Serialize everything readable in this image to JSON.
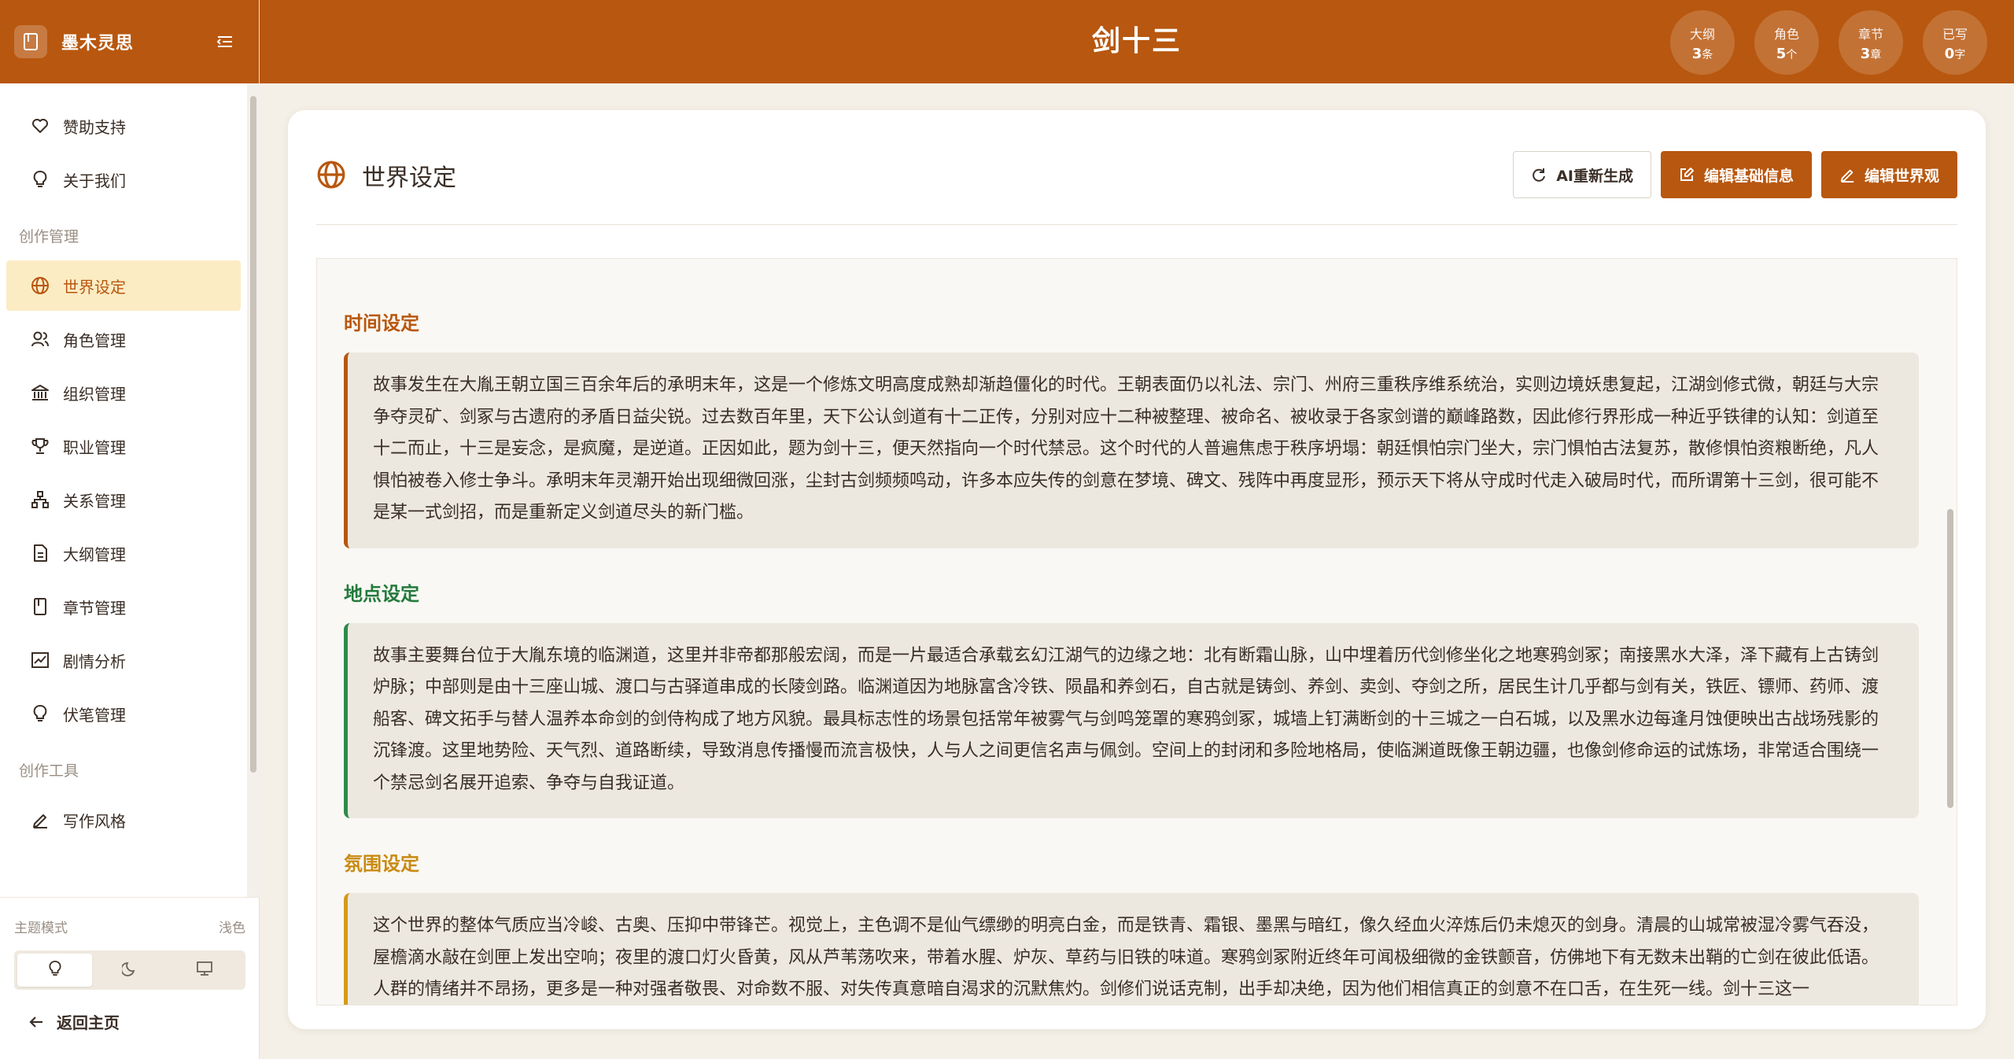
{
  "app": {
    "name": "墨木灵思",
    "novel_title": "剑十三"
  },
  "stats": [
    {
      "label": "大纲",
      "value": "3",
      "unit": "条"
    },
    {
      "label": "角色",
      "value": "5",
      "unit": "个"
    },
    {
      "label": "章节",
      "value": "3",
      "unit": "章"
    },
    {
      "label": "已写",
      "value": "0",
      "unit": "字"
    }
  ],
  "sidebar": {
    "top_items": [
      {
        "label": "赞助支持",
        "icon": "heart-icon"
      },
      {
        "label": "关于我们",
        "icon": "lightbulb-icon"
      }
    ],
    "group_manage": "创作管理",
    "manage_items": [
      {
        "label": "世界设定",
        "icon": "globe-icon",
        "active": true
      },
      {
        "label": "角色管理",
        "icon": "users-icon"
      },
      {
        "label": "组织管理",
        "icon": "building-icon"
      },
      {
        "label": "职业管理",
        "icon": "trophy-icon"
      },
      {
        "label": "关系管理",
        "icon": "network-icon"
      },
      {
        "label": "大纲管理",
        "icon": "document-icon"
      },
      {
        "label": "章节管理",
        "icon": "book-icon"
      },
      {
        "label": "剧情分析",
        "icon": "chart-icon"
      },
      {
        "label": "伏笔管理",
        "icon": "lightbulb-icon"
      }
    ],
    "group_tools": "创作工具",
    "tool_items": [
      {
        "label": "写作风格",
        "icon": "pen-icon"
      }
    ],
    "theme_label": "主题模式",
    "theme_current": "浅色",
    "back_label": "返回主页"
  },
  "page": {
    "title": "世界设定",
    "actions": {
      "regenerate": "AI重新生成",
      "edit_basic": "编辑基础信息",
      "edit_world": "编辑世界观"
    }
  },
  "sections": {
    "time": {
      "title": "时间设定",
      "text": "故事发生在大胤王朝立国三百余年后的承明末年，这是一个修炼文明高度成熟却渐趋僵化的时代。王朝表面仍以礼法、宗门、州府三重秩序维系统治，实则边境妖患复起，江湖剑修式微，朝廷与大宗争夺灵矿、剑冢与古遗府的矛盾日益尖锐。过去数百年里，天下公认剑道有十二正传，分别对应十二种被整理、被命名、被收录于各家剑谱的巅峰路数，因此修行界形成一种近乎铁律的认知：剑道至十二而止，十三是妄念，是疯魔，是逆道。正因如此，题为剑十三，便天然指向一个时代禁忌。这个时代的人普遍焦虑于秩序坍塌：朝廷惧怕宗门坐大，宗门惧怕古法复苏，散修惧怕资粮断绝，凡人惧怕被卷入修士争斗。承明末年灵潮开始出现细微回涨，尘封古剑频频鸣动，许多本应失传的剑意在梦境、碑文、残阵中再度显形，预示天下将从守成时代走入破局时代，而所谓第十三剑，很可能不是某一式剑招，而是重新定义剑道尽头的新门槛。"
    },
    "place": {
      "title": "地点设定",
      "text": "故事主要舞台位于大胤东境的临渊道，这里并非帝都那般宏阔，而是一片最适合承载玄幻江湖气的边缘之地：北有断霜山脉，山中埋着历代剑修坐化之地寒鸦剑冢；南接黑水大泽，泽下藏有上古铸剑炉脉；中部则是由十三座山城、渡口与古驿道串成的长陵剑路。临渊道因为地脉富含冷铁、陨晶和养剑石，自古就是铸剑、养剑、卖剑、夺剑之所，居民生计几乎都与剑有关，铁匠、镖师、药师、渡船客、碑文拓手与替人温养本命剑的剑侍构成了地方风貌。最具标志性的场景包括常年被雾气与剑鸣笼罩的寒鸦剑冢，城墙上钉满断剑的十三城之一白石城，以及黑水边每逢月蚀便映出古战场残影的沉锋渡。这里地势险、天气烈、道路断续，导致消息传播慢而流言极快，人与人之间更信名声与佩剑。空间上的封闭和多险地格局，使临渊道既像王朝边疆，也像剑修命运的试炼场，非常适合围绕一个禁忌剑名展开追索、争夺与自我证道。"
    },
    "atmosphere": {
      "title": "氛围设定",
      "text": "这个世界的整体气质应当冷峻、古奥、压抑中带锋芒。视觉上，主色调不是仙气缥缈的明亮白金，而是铁青、霜银、墨黑与暗红，像久经血火淬炼后仍未熄灭的剑身。清晨的山城常被湿冷雾气吞没，屋檐滴水敲在剑匣上发出空响；夜里的渡口灯火昏黄，风从芦苇荡吹来，带着水腥、炉灰、草药与旧铁的味道。寒鸦剑冢附近终年可闻极细微的金铁颤音，仿佛地下有无数未出鞘的亡剑在彼此低语。人群的情绪并不昂扬，更多是一种对强者敬畏、对命数不服、对失传真意暗自渴求的沉默焦灼。剑修们说话克制，出手却决绝，因为他们相信真正的剑意不在口舌，在生死一线。剑十三这一"
    }
  }
}
